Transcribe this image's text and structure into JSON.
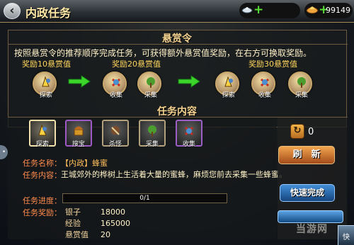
{
  "header": {
    "back_symbol": "‹",
    "title": "内政任务",
    "resource_left": {
      "icon": "silver-ingot-icon",
      "plus": "+",
      "value": ""
    },
    "resource_right": {
      "icon": "gold-ingot-icon",
      "plus": "+",
      "value": "99149"
    }
  },
  "bounty": {
    "title": "悬赏令",
    "description": "按照悬赏令的推荐顺序完成任务，可获得额外悬赏值奖励，在右方可换取奖励。",
    "rewards": [
      {
        "label": "奖励10悬赏值"
      },
      {
        "label": "奖励20悬赏值"
      },
      {
        "label": "奖励30悬赏值"
      }
    ],
    "steps": [
      {
        "label": "探索",
        "icon": "explore-icon"
      },
      {
        "label": "收集",
        "icon": "collect-icon"
      },
      {
        "label": "采集",
        "icon": "gather-icon"
      },
      {
        "label": "探索",
        "icon": "explore-icon"
      },
      {
        "label": "收集",
        "icon": "collect-icon"
      },
      {
        "label": "采集",
        "icon": "gather-icon"
      }
    ],
    "arrow_icon": "right-arrow-icon"
  },
  "task": {
    "title": "任务内容",
    "icons": [
      {
        "label": "探索",
        "icon": "explore-icon"
      },
      {
        "label": "搜宝",
        "icon": "treasure-search-icon"
      },
      {
        "label": "杀怪",
        "icon": "monster-kill-icon"
      },
      {
        "label": "采集",
        "icon": "gather-icon"
      },
      {
        "label": "收集",
        "icon": "collect-icon"
      }
    ],
    "name_label": "任务名称：",
    "name_value": "【内政】蜂蜜",
    "content_label": "任务内容：",
    "content_value": "王城郊外的桦树上生活着大量的蜜蜂，麻烦您前去采集一些蜂蜜。",
    "progress_label": "任务进度：",
    "progress_text": "0/1",
    "progress": 0,
    "reward_label": "任务奖励：",
    "rewards": [
      {
        "name": "银子",
        "value": "18000"
      },
      {
        "name": "经验",
        "value": "165000"
      },
      {
        "name": "悬赏值",
        "value": "20"
      }
    ]
  },
  "side": {
    "refresh_count": "0",
    "refresh_icon": "refresh-scroll-icon",
    "refresh_button": "刷　新",
    "quick_button": "快速完成",
    "corner_button": "快"
  },
  "watermark": "当游网"
}
